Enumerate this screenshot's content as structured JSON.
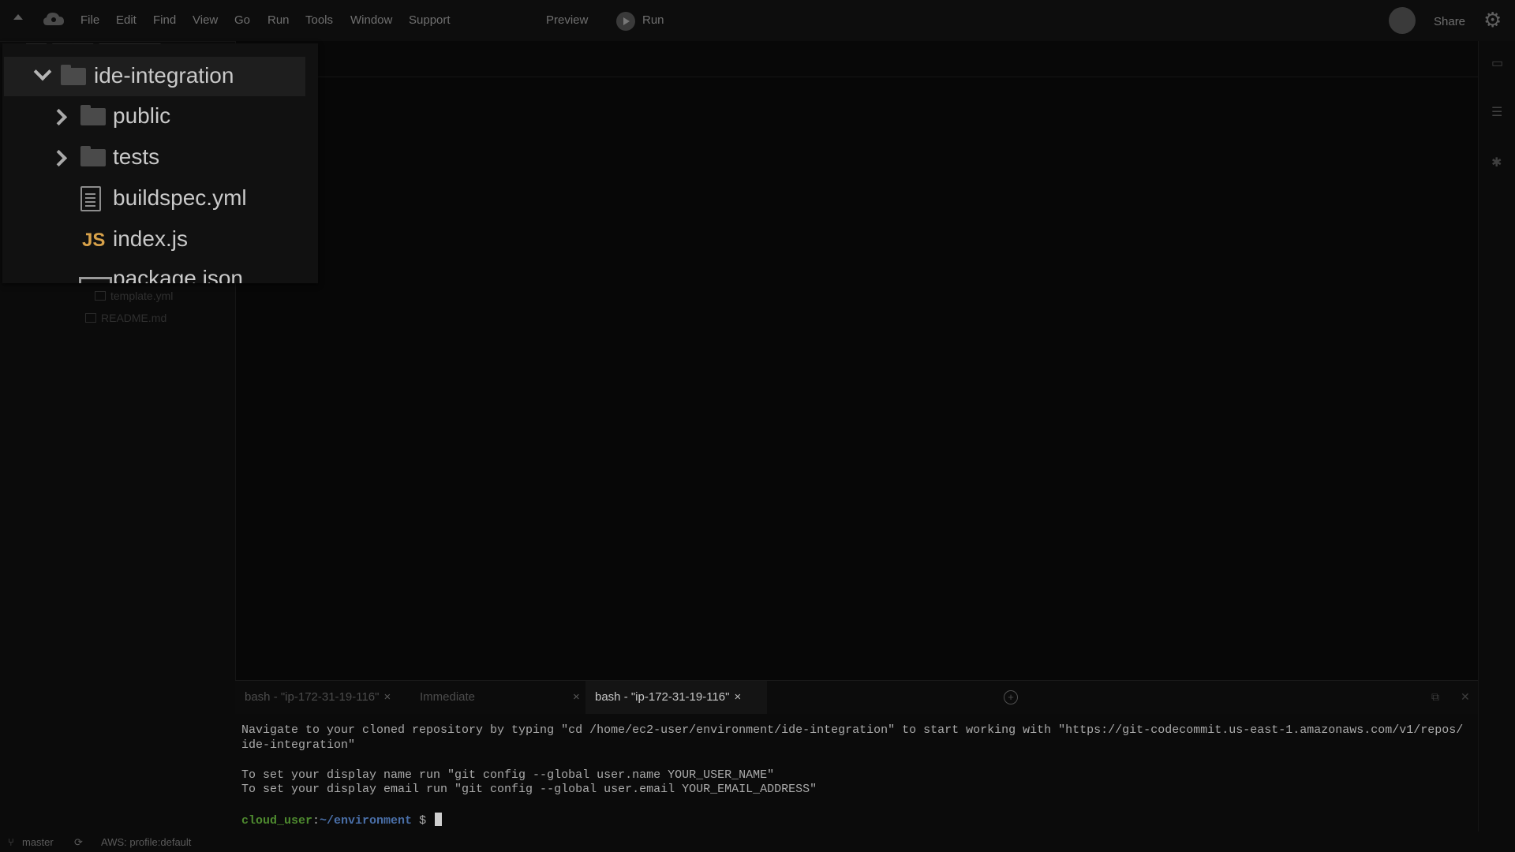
{
  "menubar": {
    "items": [
      "File",
      "Edit",
      "Find",
      "View",
      "Go",
      "Run",
      "Tools",
      "Window",
      "Support"
    ],
    "preview_label": "Preview",
    "run_label": "Run",
    "share_label": "Share"
  },
  "file_tree_zoom": {
    "top_clipped_text": "—  ——  ———",
    "root_folder": "ide-integration",
    "items": [
      {
        "label": "public",
        "type": "folder",
        "icon": "folder-icon"
      },
      {
        "label": "tests",
        "type": "folder",
        "icon": "folder-icon"
      },
      {
        "label": "buildspec.yml",
        "type": "file",
        "icon": "document-icon"
      },
      {
        "label": "index.js",
        "type": "file",
        "icon": "javascript-icon",
        "icon_text": "JS"
      },
      {
        "label": "package.json",
        "type": "file",
        "icon": "package-icon"
      }
    ]
  },
  "file_tree_bg": {
    "items": [
      "template.yml",
      "README.md"
    ]
  },
  "terminal": {
    "tabs": [
      {
        "label": "bash - \"ip-172-31-19-116\"",
        "active": false
      },
      {
        "label": "Immediate",
        "active": false
      },
      {
        "label": "bash - \"ip-172-31-19-116\"",
        "active": true
      }
    ],
    "close_glyph": "×",
    "lines": [
      "Navigate to your cloned repository by typing \"cd /home/ec2-user/environment/ide-integration\" to start working with \"https://git-codecommit.us-east-1.amazonaws.com/v1/repos/",
      "ide-integration\"",
      "",
      "To set your display name run \"git config --global user.name YOUR_USER_NAME\"",
      "To set your display email run \"git config --global user.email YOUR_EMAIL_ADDRESS\""
    ],
    "prompt_user": "cloud_user",
    "prompt_sep": ":",
    "prompt_path": "~/environment",
    "prompt_symbol": " $ "
  },
  "statusbar": {
    "branch": "master",
    "aws_profile": "AWS: profile:default"
  }
}
